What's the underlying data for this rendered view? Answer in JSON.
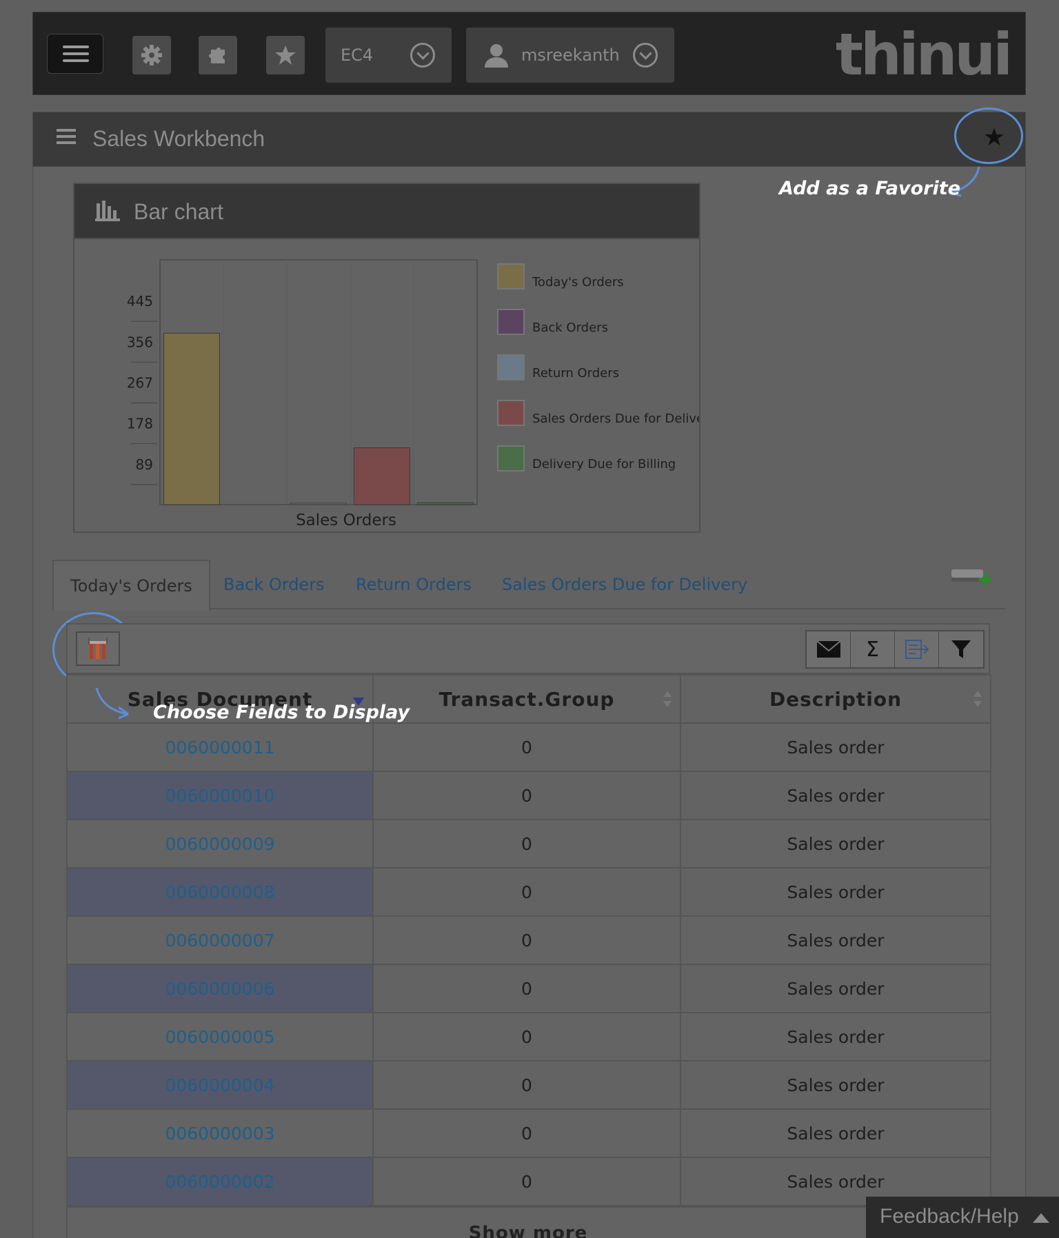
{
  "header": {
    "env_label": "EC4",
    "user_name": "msreekanth",
    "logo_text": "thinui"
  },
  "titlebar": {
    "title": "Sales Workbench"
  },
  "annotations": {
    "favorite": "Add as a Favorite",
    "choose_fields": "Choose Fields to Display"
  },
  "chart_panel": {
    "title": "Bar chart"
  },
  "chart_data": {
    "type": "bar",
    "xlabel": "Sales Orders",
    "ylabel": "",
    "ylim": [
      0,
      534
    ],
    "y_ticks": [
      "89",
      "178",
      "267",
      "356",
      "445"
    ],
    "legend_placement": "right",
    "grid": true,
    "series": [
      {
        "name": "Today's Orders",
        "value": 374,
        "color": "#7a6e48"
      },
      {
        "name": "Back Orders",
        "value": 0,
        "color": "#5a4460"
      },
      {
        "name": "Return Orders",
        "value": 3,
        "color": "#6b7a88"
      },
      {
        "name": "Sales Orders Due for Delivery",
        "value": 124,
        "color": "#7a4a4a"
      },
      {
        "name": "Delivery Due for Billing",
        "value": 4,
        "color": "#4a6e48"
      }
    ]
  },
  "tabs": [
    {
      "label": "Today's Orders",
      "active": true
    },
    {
      "label": "Back Orders",
      "active": false
    },
    {
      "label": "Return Orders",
      "active": false
    },
    {
      "label": "Sales Orders Due for Delivery",
      "active": false
    }
  ],
  "table": {
    "columns": [
      "Sales Document",
      "Transact.Group",
      "Description"
    ],
    "rows": [
      [
        "0060000011",
        "0",
        "Sales order"
      ],
      [
        "0060000010",
        "0",
        "Sales order"
      ],
      [
        "0060000009",
        "0",
        "Sales order"
      ],
      [
        "0060000008",
        "0",
        "Sales order"
      ],
      [
        "0060000007",
        "0",
        "Sales order"
      ],
      [
        "0060000006",
        "0",
        "Sales order"
      ],
      [
        "0060000005",
        "0",
        "Sales order"
      ],
      [
        "0060000004",
        "0",
        "Sales order"
      ],
      [
        "0060000003",
        "0",
        "Sales order"
      ],
      [
        "0060000002",
        "0",
        "Sales order"
      ]
    ],
    "show_more": "Show more"
  },
  "feedback": {
    "label": "Feedback/Help"
  },
  "icons": {
    "menu": "hamburger-icon",
    "settings": "gear-icon",
    "puzzle": "puzzle-icon",
    "favorites": "star-icon",
    "user": "user-icon",
    "email": "envelope-icon",
    "sum": "sigma-icon",
    "export": "export-icon",
    "filter": "filter-icon"
  }
}
